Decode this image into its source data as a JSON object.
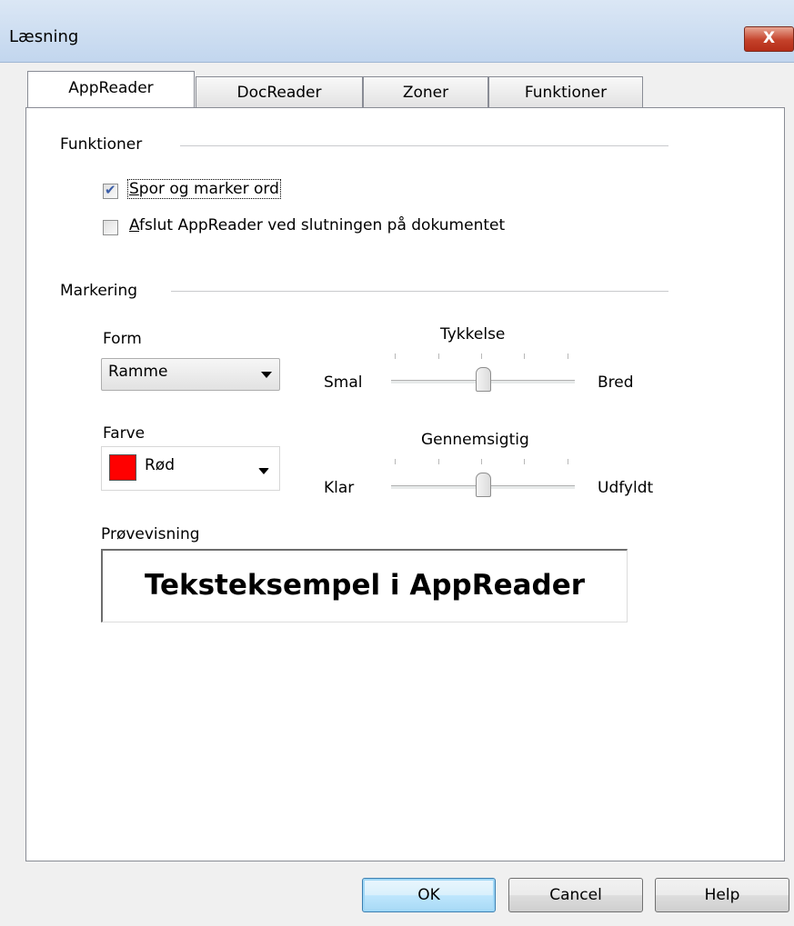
{
  "window": {
    "title": "Læsning",
    "close_label": "X"
  },
  "tabs": [
    {
      "label": "AppReader",
      "active": true
    },
    {
      "label": "DocReader",
      "active": false
    },
    {
      "label": "Zoner",
      "active": false
    },
    {
      "label": "Funktioner",
      "active": false
    }
  ],
  "funktioner": {
    "group_label": "Funktioner",
    "options": [
      {
        "underline": "S",
        "rest": "por og marker ord",
        "checked": true
      },
      {
        "underline": "A",
        "rest": "fslut AppReader ved slutningen på dokumentet",
        "checked": false
      }
    ]
  },
  "markering": {
    "group_label": "Markering",
    "form_label": "Form",
    "form_value": "Ramme",
    "farve_label": "Farve",
    "farve_value": "Rød",
    "farve_color": "#ff0000",
    "tykkelse": {
      "label": "Tykkelse",
      "min_label": "Smal",
      "max_label": "Bred",
      "level": 0.5
    },
    "gennemsigtig": {
      "label": "Gennemsigtig",
      "min_label": "Klar",
      "max_label": "Udfyldt",
      "level": 0.5
    },
    "preview_label": "Prøvevisning",
    "preview_text": "Teksteksempel i AppReader"
  },
  "buttons": {
    "ok": "OK",
    "cancel": "Cancel",
    "help": "Help"
  }
}
